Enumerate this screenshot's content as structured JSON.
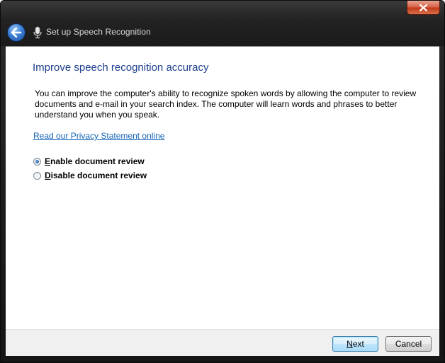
{
  "window": {
    "title": "Set up Speech Recognition"
  },
  "titlebar": {
    "close_icon": "close-icon",
    "back_icon": "back-arrow-icon",
    "app_icon": "microphone-icon"
  },
  "main": {
    "heading": "Improve speech recognition accuracy",
    "description": "You can improve the computer's ability to recognize spoken words by allowing the computer to review documents and e-mail in your search index. The computer will learn words and phrases to better understand you when you speak.",
    "privacy_link": "Read our Privacy Statement online",
    "options": [
      {
        "mnemonic": "E",
        "rest": "nable document review",
        "selected": true
      },
      {
        "mnemonic": "D",
        "rest": "isable document review",
        "selected": false
      }
    ]
  },
  "footer": {
    "next_mnemonic": "N",
    "next_rest": "ext",
    "cancel_label": "Cancel"
  },
  "colors": {
    "heading": "#1c3e8c",
    "link": "#1464b8",
    "close_button": "#c13a1b",
    "back_button": "#3b7fd4"
  }
}
